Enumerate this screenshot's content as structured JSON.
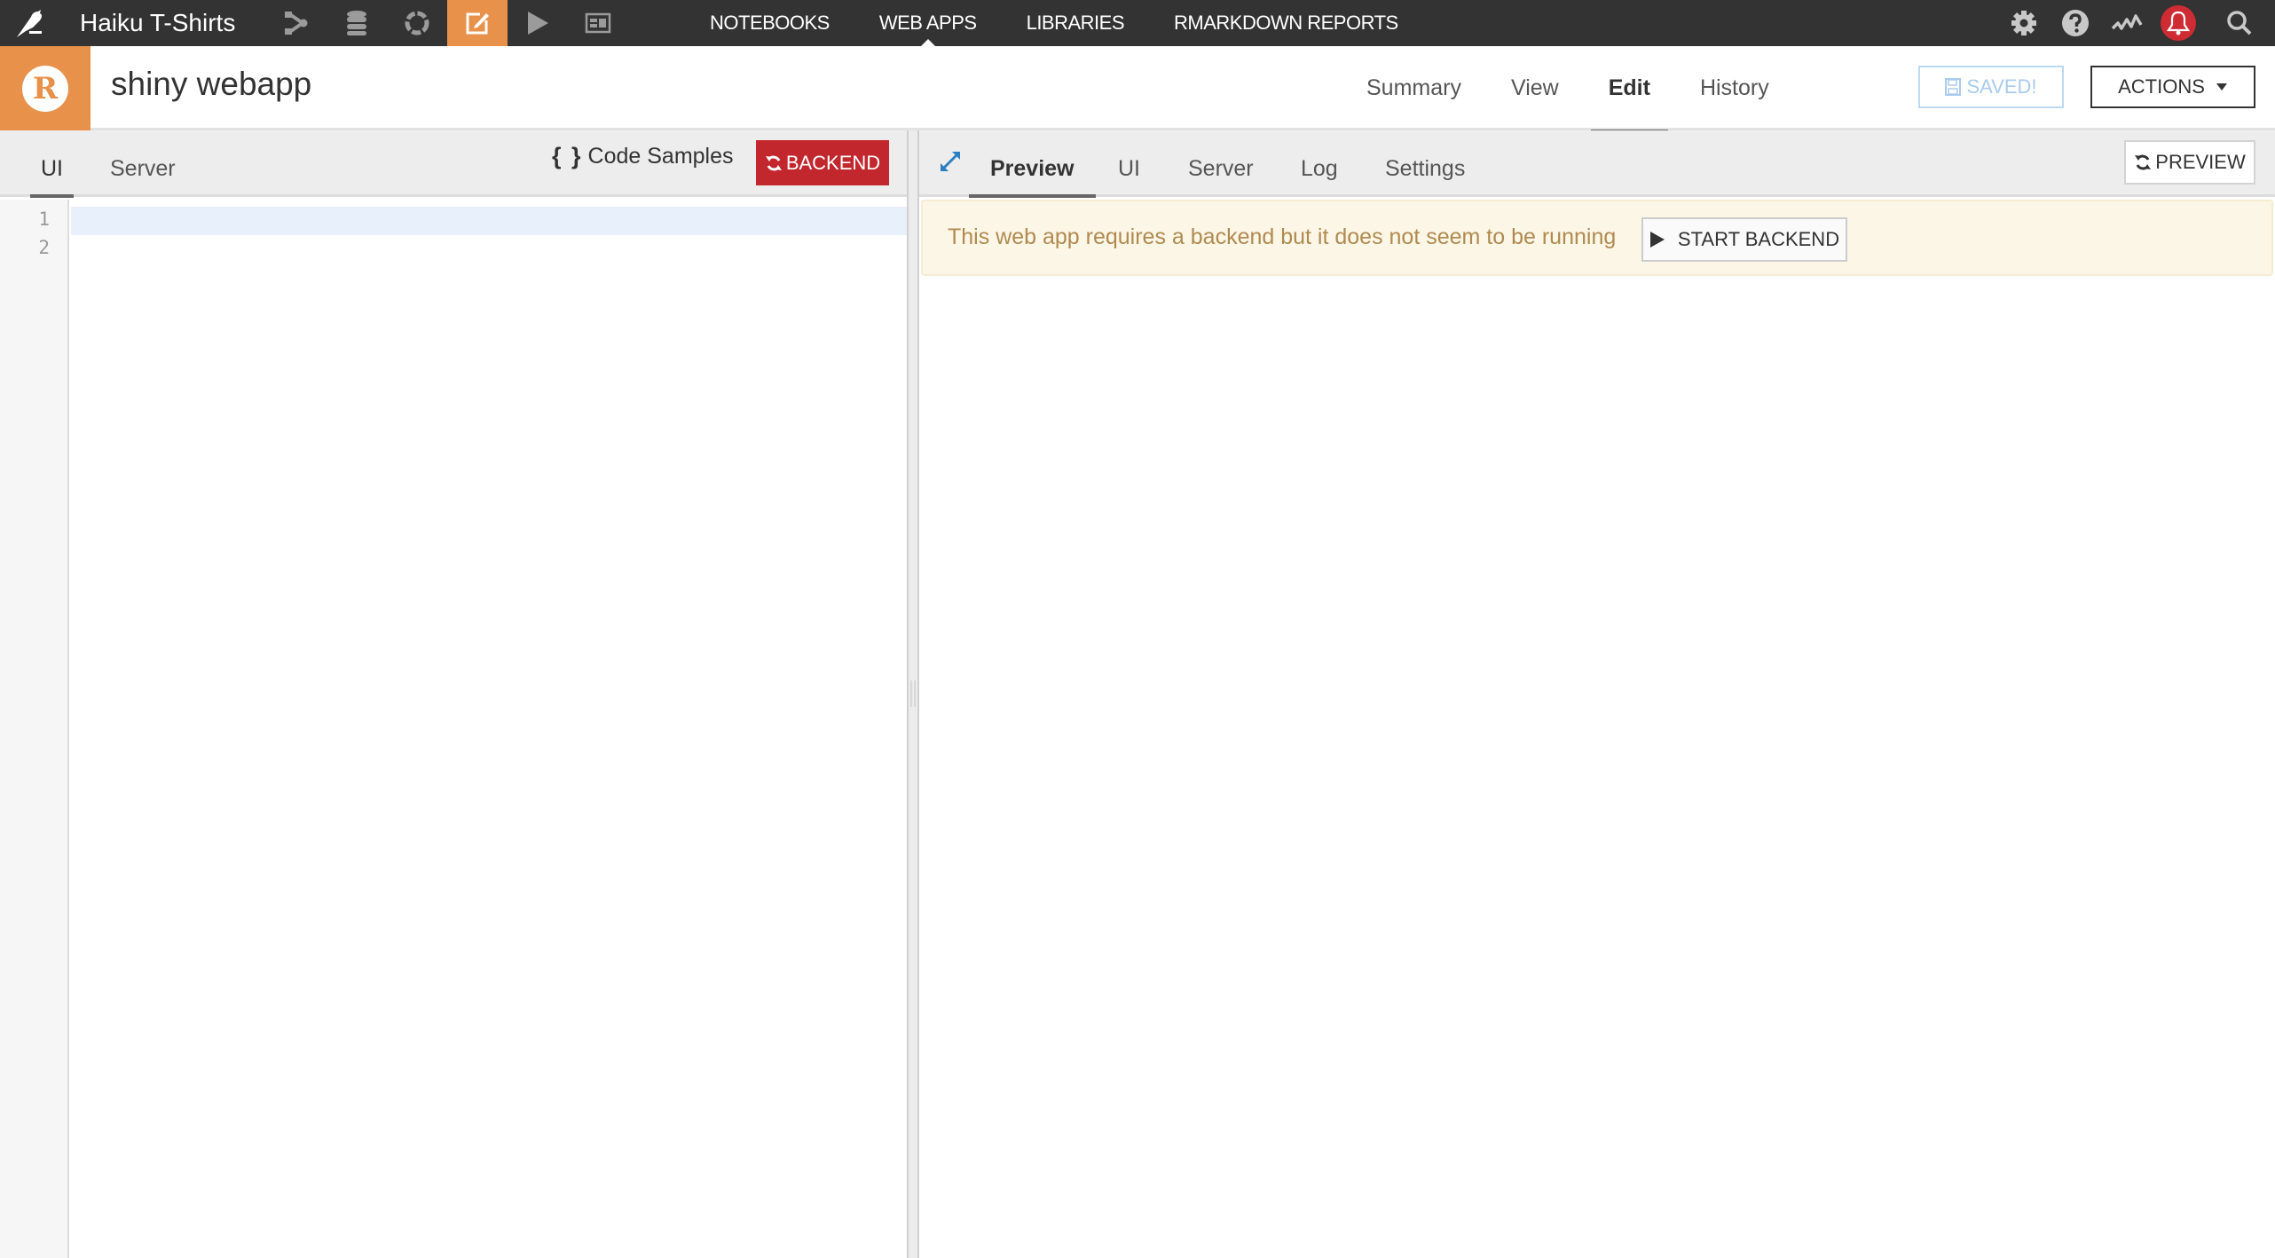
{
  "topbar": {
    "project_name": "Haiku T-Shirts",
    "icons": [
      {
        "name": "flow-icon",
        "active": false
      },
      {
        "name": "datasets-icon",
        "active": false
      },
      {
        "name": "recipes-icon",
        "active": false
      },
      {
        "name": "code-edit-icon",
        "active": true
      },
      {
        "name": "jobs-play-icon",
        "active": false
      },
      {
        "name": "dashboard-icon",
        "active": false
      }
    ],
    "nav_links": [
      "NOTEBOOKS",
      "WEB APPS",
      "LIBRARIES",
      "RMARKDOWN REPORTS"
    ],
    "active_nav": "WEB APPS",
    "right_icons": [
      "gear-icon",
      "help-icon",
      "activity-icon",
      "bell-icon",
      "search-icon"
    ]
  },
  "header": {
    "title": "shiny webapp",
    "object_icon": "R",
    "tabs": [
      "Summary",
      "View",
      "Edit",
      "History"
    ],
    "active_tab": "Edit",
    "saved_label": "SAVED!",
    "actions_label": "ACTIONS"
  },
  "editor": {
    "tabs": [
      "UI",
      "Server"
    ],
    "active_tab": "UI",
    "code_samples_label": "Code Samples",
    "code_samples_braces": "{ }",
    "backend_label": "BACKEND",
    "line_numbers": [
      "1",
      "2"
    ]
  },
  "preview": {
    "tabs": [
      "Preview",
      "UI",
      "Server",
      "Log",
      "Settings"
    ],
    "active_tab": "Preview",
    "preview_button_label": "PREVIEW",
    "alert_text": "This web app requires a backend but it does not seem to be running",
    "start_backend_label": "START BACKEND"
  },
  "colors": {
    "accent_orange": "#E8914A",
    "topbar_bg": "#333333",
    "backend_red": "#C1272D",
    "notification_red": "#CE2B33",
    "alert_bg": "#FCF6E6",
    "alert_text": "#B08A50",
    "saved_blue": "#A9CBED"
  }
}
